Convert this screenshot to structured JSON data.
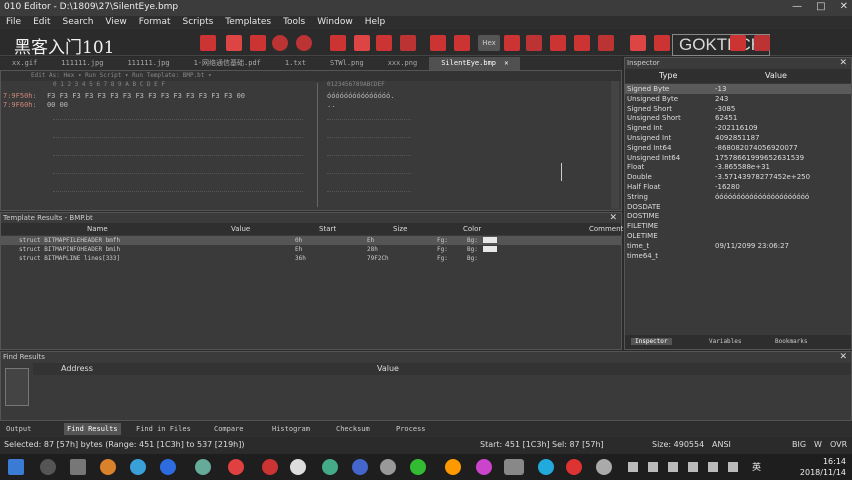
{
  "window": {
    "title": "010 Editor - D:\\1809\\27\\SilentEye.bmp",
    "controls": [
      "—",
      "□",
      "✕"
    ]
  },
  "watermark_left": "黑客入门101",
  "watermark_right": "GOKTECH",
  "menu": [
    "File",
    "Edit",
    "Search",
    "View",
    "Format",
    "Scripts",
    "Templates",
    "Tools",
    "Window",
    "Help"
  ],
  "toolbar_icons": [
    "new-icon",
    "open-icon",
    "save-icon",
    "cut-icon",
    "copy-icon",
    "paste-icon",
    "undo-icon",
    "redo-icon",
    "find-icon",
    "replace-icon",
    "goto-icon",
    "font-icon",
    "highlight-icon",
    "hex-icon",
    "bookmark-icon",
    "paragraph-icon",
    "compare-icon",
    "calculator-icon",
    "chart-icon",
    "settings-icon"
  ],
  "toolbar_hex_label": "Hex",
  "tabs": [
    {
      "label": "xx.gif"
    },
    {
      "label": "111111.jpg"
    },
    {
      "label": "111111.jpg"
    },
    {
      "label": "1-网络通信基础.pdf"
    },
    {
      "label": "1.txt"
    },
    {
      "label": "STWl.png"
    },
    {
      "label": "xxx.png"
    },
    {
      "label": "SilentEye.bmp",
      "close": "✕"
    }
  ],
  "hex": {
    "header": "Edit As: Hex ▾    Run Script ▾    Run Template: BMP.bt ▾",
    "columns": "0  1  2  3  4  5  6  7  8  9  A  B  C  D  E  F",
    "ascii_header": "0123456789ABCDEF",
    "rows": [
      {
        "addr": "7:9F50h:",
        "bytes": "F3 F3 F3 F3 F3 F3 F3 F3 F3 F3 F3 F3 F3 F3 F3 00",
        "ascii": "óóóóóóóóóóóóóóó."
      },
      {
        "addr": "7:9F60h:",
        "bytes": "00 00",
        "ascii": ".."
      }
    ]
  },
  "template_results": {
    "header": "Template Results - BMP.bt",
    "columns": [
      "Name",
      "Value",
      "Start",
      "Size",
      "Color",
      "Comment"
    ],
    "rows": [
      {
        "name": "struct BITMAPFILEHEADER bmfh",
        "start": "0h",
        "size": "Eh",
        "fg": "Fg:",
        "bg": "Bg:"
      },
      {
        "name": "struct BITMAPINFOHEADER bmih",
        "start": "Eh",
        "size": "28h",
        "fg": "Fg:",
        "bg": "Bg:"
      },
      {
        "name": "struct BITMAPLINE lines[333]",
        "start": "36h",
        "size": "79F2Ch",
        "fg": "Fg:",
        "bg": "Bg:"
      }
    ]
  },
  "inspector": {
    "header": "Inspector",
    "columns": [
      "Type",
      "Value"
    ],
    "rows": [
      {
        "type": "Signed Byte",
        "value": "-13"
      },
      {
        "type": "Unsigned Byte",
        "value": "243"
      },
      {
        "type": "Signed Short",
        "value": "-3085"
      },
      {
        "type": "Unsigned Short",
        "value": "62451"
      },
      {
        "type": "Signed Int",
        "value": "-202116109"
      },
      {
        "type": "Unsigned Int",
        "value": "4092851187"
      },
      {
        "type": "Signed Int64",
        "value": "-868082074056920077"
      },
      {
        "type": "Unsigned Int64",
        "value": "17578661999652631539"
      },
      {
        "type": "Float",
        "value": "-3.865588e+31"
      },
      {
        "type": "Double",
        "value": "-3.57143978277452e+250"
      },
      {
        "type": "Half Float",
        "value": "-16280"
      },
      {
        "type": "String",
        "value": "óóóóóóóóóóóóóóóóóóóóóó"
      },
      {
        "type": "DOSDATE",
        "value": ""
      },
      {
        "type": "DOSTIME",
        "value": ""
      },
      {
        "type": "FILETIME",
        "value": ""
      },
      {
        "type": "OLETIME",
        "value": ""
      },
      {
        "type": "time_t",
        "value": "09/11/2099 23:06:27"
      },
      {
        "type": "time64_t",
        "value": ""
      }
    ],
    "tabs": [
      "Inspector",
      "Variables",
      "Bookmarks"
    ]
  },
  "find_results": {
    "header": "Find Results",
    "columns": [
      "Address",
      "Value"
    ]
  },
  "output_tabs": [
    "Output",
    "Find Results",
    "Find in Files",
    "Compare",
    "Histogram",
    "Checksum",
    "Process"
  ],
  "status": {
    "selected": "Selected: 87 [57h] bytes (Range: 451 [1C3h] to 537 [219h])",
    "start": "Start: 451 [1C3h]",
    "sel": "Sel: 87 [57h]",
    "size": "Size: 490554",
    "encoding": "ANSI",
    "endian": "BIG",
    "w": "W",
    "ovr": "OVR"
  },
  "taskbar": {
    "time": "16:14",
    "date": "2018/11/14",
    "lang": "英"
  }
}
